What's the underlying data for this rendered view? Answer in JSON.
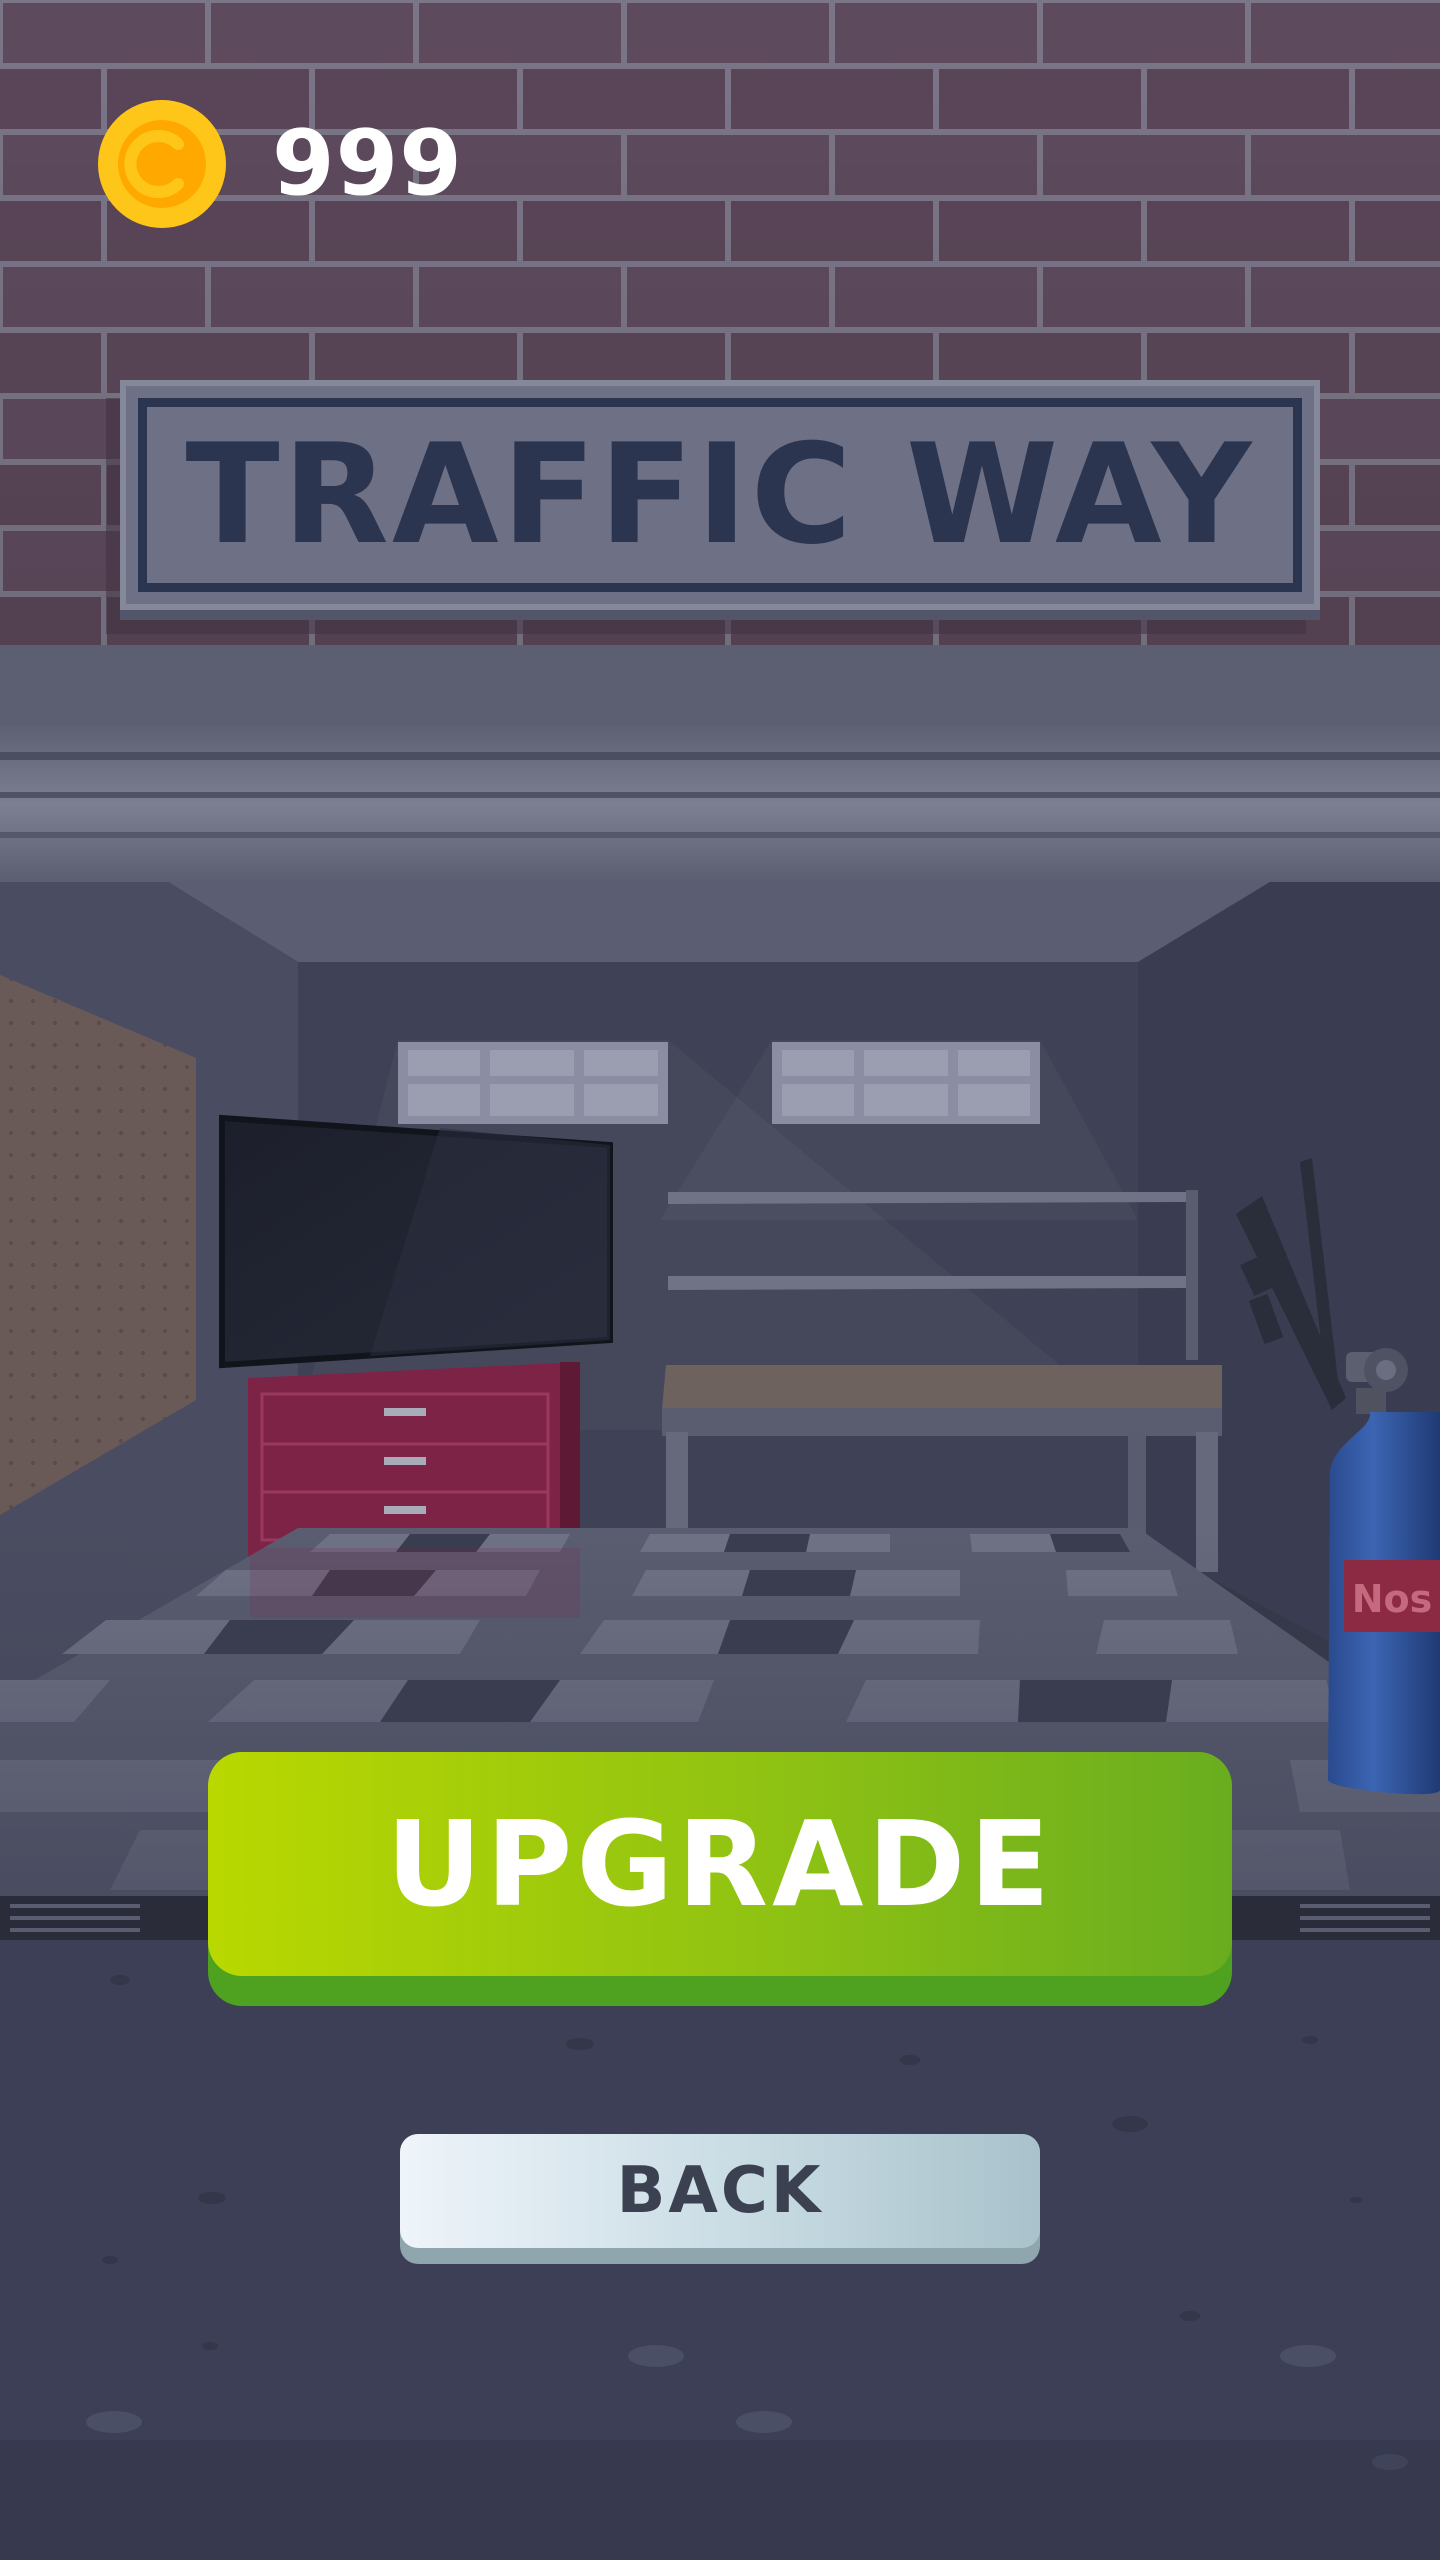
{
  "hud": {
    "coin_icon": "coin-icon",
    "coins": "999"
  },
  "title": {
    "text": "TRAFFIC WAY"
  },
  "buttons": {
    "upgrade": "UPGRADE",
    "back": "BACK"
  },
  "props": {
    "nos_label": "Nos"
  },
  "colors": {
    "brick": "#5e4a5d",
    "garage_wall": "#3d4056",
    "upgrade_green": "#8fc213",
    "back_light": "#c8dbe3",
    "coin_gold": "#ffc107",
    "title_navy": "#2b3550"
  }
}
